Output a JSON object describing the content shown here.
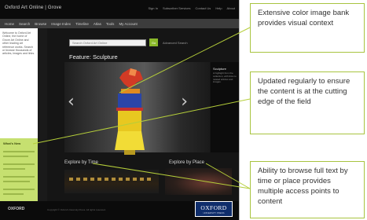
{
  "screenshot": {
    "site_title": "Oxford Art Online | Grove",
    "top_links": [
      "Sign In",
      "Subscriber Services",
      "Contact Us",
      "Help",
      "About"
    ],
    "nav_tabs": [
      "Home",
      "Search",
      "Browse",
      "Image Index",
      "Timeline",
      "Atlas",
      "Tools",
      "My Account"
    ],
    "left_text": "Welcome to Oxford Art Online, the home of Grove Art Online and other leading art reference works. Search or browse thousands of articles, images and links.",
    "left_green_title": "What's New",
    "search_placeholder": "Search Oxford Art Online",
    "search_go": "Go",
    "search_link": "Advanced Search",
    "section_title": "Feature: Sculpture",
    "prev_arrow": "‹",
    "next_arrow": "›",
    "feature_title": "Sculpture",
    "feature_text": "A highlight from the collection, with links to related articles and images.",
    "browse_time_label": "Explore by Time",
    "browse_place_label": "Explore by Place",
    "footer_logo": "OXFORD",
    "footer_text": "Copyright © Oxford University Press. All rights reserved.",
    "oxford_name": "OXFORD",
    "oxford_press": "UNIVERSITY PRESS"
  },
  "callouts": [
    {
      "text": "Extensive color image bank provides visual context"
    },
    {
      "text": "Updated regularly to ensure the content is at the cutting edge of the field"
    },
    {
      "text": "Ability to browse full text by time or place provides multiple access points to content"
    }
  ],
  "colors": {
    "callout_border": "#a8c440",
    "leader_line": "#b5ce3a",
    "sidebar_green": "#c6e070",
    "page_dark": "#1a1a1a",
    "oxford_blue": "#0f2d6b"
  }
}
